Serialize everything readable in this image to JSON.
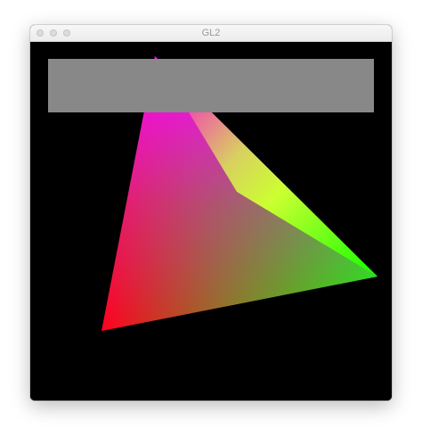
{
  "window": {
    "title": "GL2",
    "buttons": [
      "close-button",
      "minimize-button",
      "zoom-button"
    ]
  },
  "colors": {
    "titlebar": "#ececec",
    "traffic_inactive": "#dcdcdc",
    "canvas_background": "#000000",
    "overlay_bar": "#888888",
    "vertex_red": "#ff0000",
    "vertex_magenta": "#ff00ff",
    "vertex_green": "#00ff00",
    "vertex_yellow": "#ffff00"
  }
}
